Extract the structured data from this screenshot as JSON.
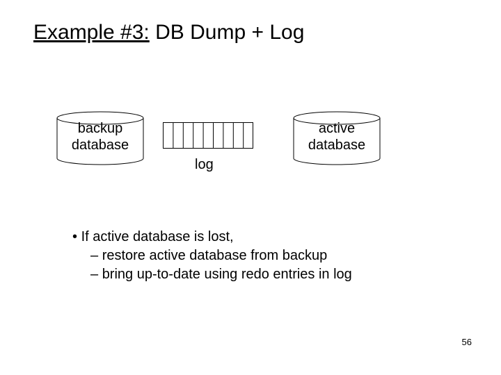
{
  "title_underlined": "Example #3:",
  "title_rest": " DB Dump + Log",
  "backup_label_line1": "backup",
  "backup_label_line2": "database",
  "active_label_line1": "active",
  "active_label_line2": "database",
  "log_label": "log",
  "bullet1": "If active database is lost,",
  "bullet1a": "restore active database from backup",
  "bullet1b": "bring up-to-date using redo entries in log",
  "page_number": "56",
  "chart_data": {
    "type": "diagram",
    "title": "DB Dump + Log",
    "nodes": [
      {
        "id": "backup_db",
        "kind": "cylinder",
        "label": "backup database"
      },
      {
        "id": "log",
        "kind": "striped-rect",
        "label": "log",
        "segments": 9
      },
      {
        "id": "active_db",
        "kind": "cylinder",
        "label": "active database"
      }
    ],
    "layout": "horizontal",
    "annotations": [
      "If active database is lost,",
      "restore active database from backup",
      "bring up-to-date using redo entries in log"
    ]
  }
}
